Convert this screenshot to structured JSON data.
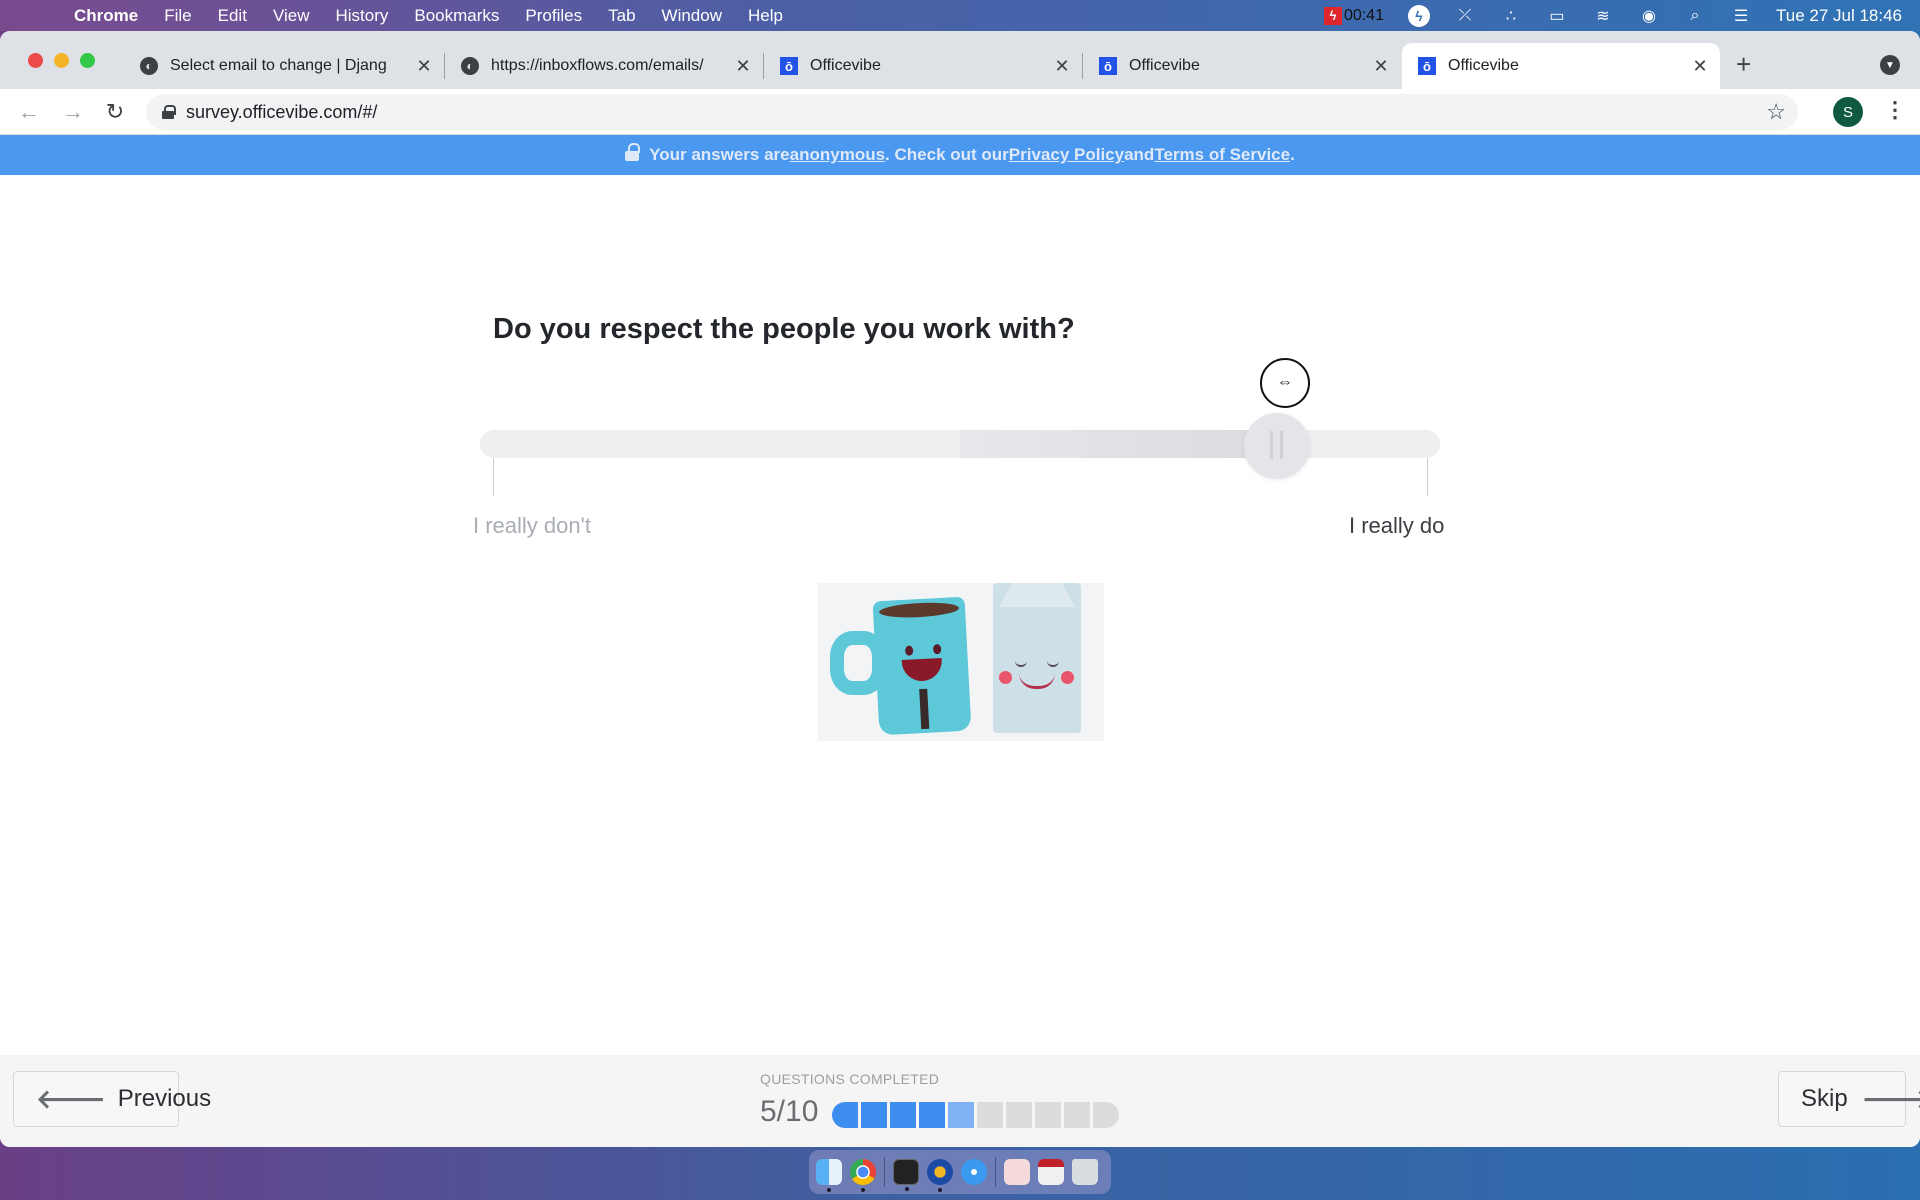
{
  "menubar": {
    "apple_icon": "apple-logo-icon",
    "app_name": "Chrome",
    "items": [
      "File",
      "Edit",
      "View",
      "History",
      "Bookmarks",
      "Profiles",
      "Tab",
      "Window",
      "Help"
    ],
    "recording_time": "00:41",
    "status_icons": [
      "screen-recorder-icon",
      "bolt-icon",
      "mute-icon",
      "dots-icon",
      "battery-charging-icon",
      "wifi-icon",
      "user-icon",
      "search-icon",
      "control-center-icon"
    ],
    "datetime": "Tue 27 Jul  18:46"
  },
  "browser": {
    "tabs": [
      {
        "title": "Select email to change | Djang",
        "favicon": "globe-icon",
        "active": false
      },
      {
        "title": "https://inboxflows.com/emails/",
        "favicon": "globe-icon",
        "active": false
      },
      {
        "title": "Officevibe",
        "favicon": "officevibe-icon",
        "active": false
      },
      {
        "title": "Officevibe",
        "favicon": "officevibe-icon",
        "active": false
      },
      {
        "title": "Officevibe",
        "favicon": "officevibe-icon",
        "active": true
      }
    ],
    "favicon_glyph": "ō",
    "close_glyph": "✕",
    "new_tab_glyph": "+",
    "url": "survey.officevibe.com/#/",
    "profile_initial": "S"
  },
  "banner": {
    "prefix": "Your answers are ",
    "link_anonymous": "anonymous",
    "middle": ". Check out our ",
    "link_privacy": "Privacy Policy",
    "and": " and ",
    "link_terms": "Terms of Service",
    "suffix": "."
  },
  "survey": {
    "question": "Do you respect the people you work with?",
    "scale_min_label": "I really don't",
    "scale_max_label": "I really do",
    "slider_value_fraction": 0.83,
    "cursor_glyph": "⇔"
  },
  "footer": {
    "previous_label": "Previous",
    "skip_label": "Skip",
    "progress_label": "QUESTIONS COMPLETED",
    "progress_count": "5/10",
    "completed": 4,
    "current": 5,
    "total": 10,
    "colors": {
      "done": "#3e8ef0",
      "current": "#7eb2f2",
      "pending": "#dcdcdc"
    }
  },
  "dock": {
    "apps": [
      "finder",
      "chrome",
      "terminal",
      "bolt-app",
      "safari",
      "document",
      "screenshot",
      "trash"
    ]
  }
}
